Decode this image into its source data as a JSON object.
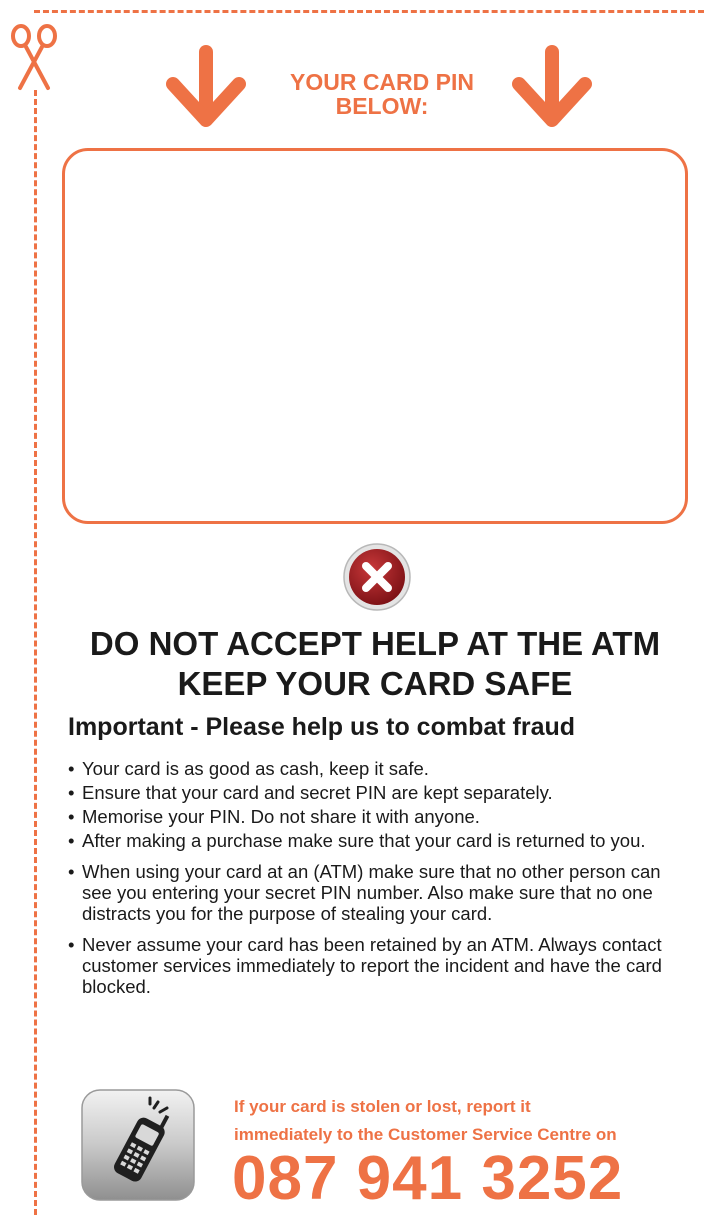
{
  "colors": {
    "accent": "#ee7245",
    "text": "#1a1a1a",
    "warning_red": "#9e1b1e"
  },
  "icons": {
    "scissors": "scissors-icon",
    "arrow": "arrow-down-icon",
    "warning": "close-circle-icon",
    "phone": "mobile-phone-icon"
  },
  "pin_section": {
    "heading_line1": "YOUR CARD PIN",
    "heading_line2": "BELOW:"
  },
  "warning": {
    "line1": "DO NOT ACCEPT HELP AT THE ATM",
    "line2": "KEEP YOUR CARD SAFE"
  },
  "important": {
    "heading": "Important - Please help us to combat fraud",
    "tips": [
      "Your card is as good as cash, keep it safe.",
      "Ensure that your card and secret PIN are kept separately.",
      "Memorise your PIN. Do not share it with anyone.",
      "After making a purchase make sure that your card is returned to you.",
      "When using your card at an (ATM) make sure that no other person can see you entering your secret PIN number. Also make sure that no one distracts you for the purpose of stealing your card.",
      "Never assume your card has been retained by an ATM. Always contact customer services immediately to report the incident and have the card blocked."
    ]
  },
  "contact": {
    "line1": "If your card is stolen or lost, report it",
    "line2": "immediately to the Customer Service Centre on",
    "phone": "087 941 3252"
  }
}
